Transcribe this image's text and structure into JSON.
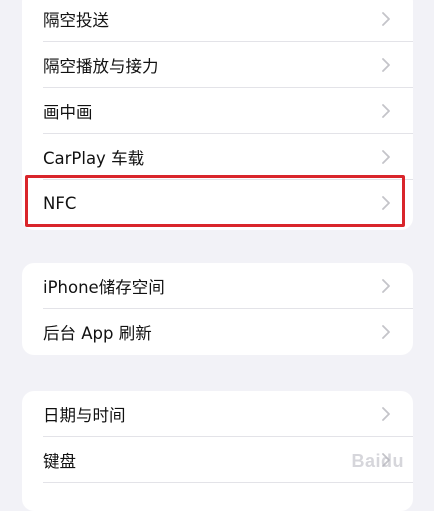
{
  "settings_groups": [
    {
      "items": [
        {
          "label": "隔空投送"
        },
        {
          "label": "隔空播放与接力"
        },
        {
          "label": "画中画"
        },
        {
          "label": "CarPlay 车载"
        },
        {
          "label": "NFC"
        }
      ]
    },
    {
      "items": [
        {
          "label": "iPhone储存空间"
        },
        {
          "label": "后台 App 刷新"
        }
      ]
    },
    {
      "items": [
        {
          "label": "日期与时间"
        },
        {
          "label": "键盘"
        }
      ]
    }
  ],
  "watermark_text": "Baidu",
  "colors": {
    "background": "#f2f2f7",
    "card": "#ffffff",
    "highlight_border": "#d9252b",
    "chevron": "#c4c4c9"
  }
}
